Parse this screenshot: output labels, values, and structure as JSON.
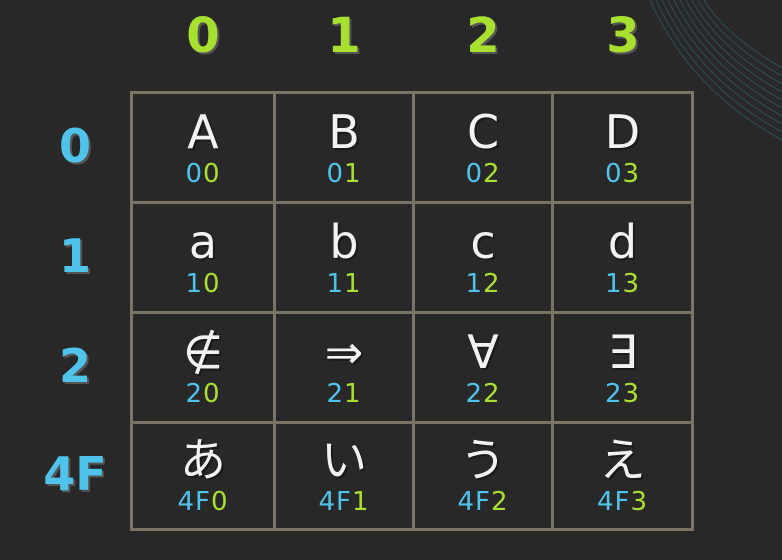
{
  "columns": [
    "0",
    "1",
    "2",
    "3"
  ],
  "rows": [
    {
      "label": "0",
      "cells": [
        {
          "glyph": "A",
          "row_code": "0",
          "col_code": "0"
        },
        {
          "glyph": "B",
          "row_code": "0",
          "col_code": "1"
        },
        {
          "glyph": "C",
          "row_code": "0",
          "col_code": "2"
        },
        {
          "glyph": "D",
          "row_code": "0",
          "col_code": "3"
        }
      ]
    },
    {
      "label": "1",
      "cells": [
        {
          "glyph": "a",
          "row_code": "1",
          "col_code": "0"
        },
        {
          "glyph": "b",
          "row_code": "1",
          "col_code": "1"
        },
        {
          "glyph": "c",
          "row_code": "1",
          "col_code": "2"
        },
        {
          "glyph": "d",
          "row_code": "1",
          "col_code": "3"
        }
      ]
    },
    {
      "label": "2",
      "cells": [
        {
          "glyph": "∉",
          "row_code": "2",
          "col_code": "0"
        },
        {
          "glyph": "⇒",
          "row_code": "2",
          "col_code": "1"
        },
        {
          "glyph": "∀",
          "row_code": "2",
          "col_code": "2"
        },
        {
          "glyph": "∃",
          "row_code": "2",
          "col_code": "3"
        }
      ]
    },
    {
      "label": "4F",
      "cells": [
        {
          "glyph": "あ",
          "row_code": "4F",
          "col_code": "0"
        },
        {
          "glyph": "い",
          "row_code": "4F",
          "col_code": "1"
        },
        {
          "glyph": "う",
          "row_code": "4F",
          "col_code": "2"
        },
        {
          "glyph": "え",
          "row_code": "4F",
          "col_code": "3"
        }
      ]
    }
  ],
  "colors": {
    "background": "#282829",
    "column_accent": "#a8e02f",
    "row_accent": "#4fc3ea",
    "grid_line": "#7a7465",
    "glyph": "#f2f2f2"
  }
}
